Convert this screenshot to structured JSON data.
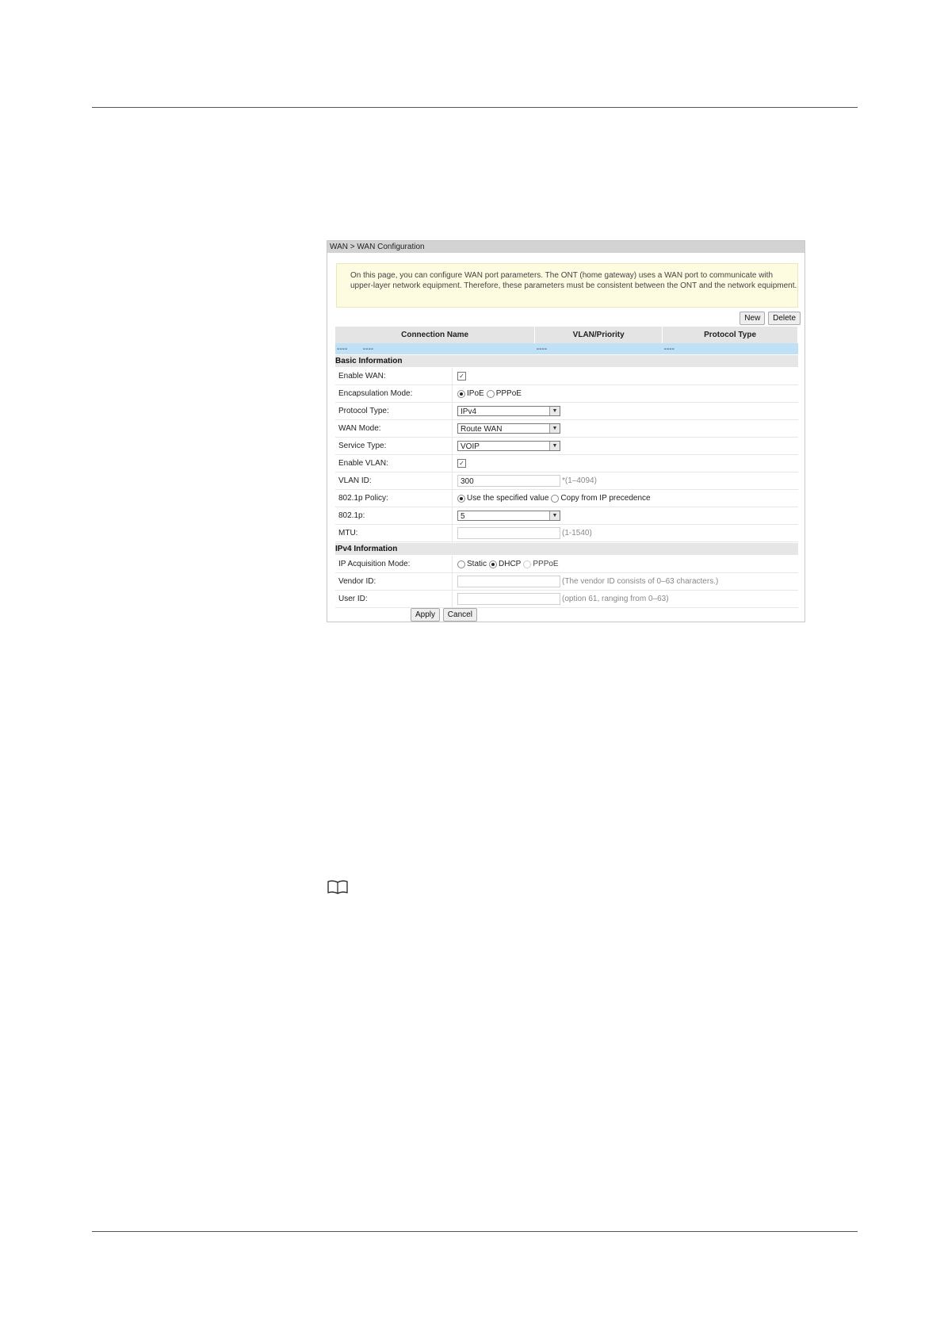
{
  "breadcrumb": "WAN > WAN Configuration",
  "notice": "On this page, you can configure WAN port parameters. The ONT (home gateway) uses a WAN port to communicate with upper-layer network equipment. Therefore, these parameters must be consistent between the ONT and the network equipment.",
  "toolbar": {
    "new_label": "New",
    "delete_label": "Delete"
  },
  "connections": {
    "headers": [
      "Connection Name",
      "VLAN/Priority",
      "Protocol Type"
    ],
    "row": {
      "c1": "----",
      "c2": "----",
      "c3": "----",
      "c4": "----"
    }
  },
  "basic": {
    "title": "Basic Information",
    "enable_wan": {
      "label": "Enable WAN:",
      "checked": true
    },
    "encapsulation": {
      "label": "Encapsulation Mode:",
      "opt1": "IPoE",
      "opt2": "PPPoE",
      "selected": "IPoE"
    },
    "protocol_type": {
      "label": "Protocol Type:",
      "value": "IPv4"
    },
    "wan_mode": {
      "label": "WAN Mode:",
      "value": "Route WAN"
    },
    "service_type": {
      "label": "Service Type:",
      "value": "VOIP"
    },
    "enable_vlan": {
      "label": "Enable VLAN:",
      "checked": true
    },
    "vlan_id": {
      "label": "VLAN ID:",
      "value": "300",
      "hint": "*(1–4094)"
    },
    "policy_8021p": {
      "label": "802.1p Policy:",
      "opt1": "Use the specified value",
      "opt2": "Copy from IP precedence",
      "selected": "Use the specified value"
    },
    "p8021": {
      "label": "802.1p:",
      "value": "5"
    },
    "mtu": {
      "label": "MTU:",
      "value": "",
      "hint": "(1-1540)"
    }
  },
  "ipv4": {
    "title": "IPv4 Information",
    "ip_mode": {
      "label": "IP Acquisition Mode:",
      "opt1": "Static",
      "opt2": "DHCP",
      "opt3": "PPPoE",
      "selected": "DHCP"
    },
    "vendor_id": {
      "label": "Vendor ID:",
      "value": "",
      "hint": "(The vendor ID consists of 0–63 characters.)"
    },
    "user_id": {
      "label": "User ID:",
      "value": "",
      "hint": "(option 61, ranging from 0–63)"
    }
  },
  "actions": {
    "apply_label": "Apply",
    "cancel_label": "Cancel"
  },
  "icons": {
    "checkmark": "✓",
    "dropdown": "▼",
    "note": "book-icon"
  }
}
